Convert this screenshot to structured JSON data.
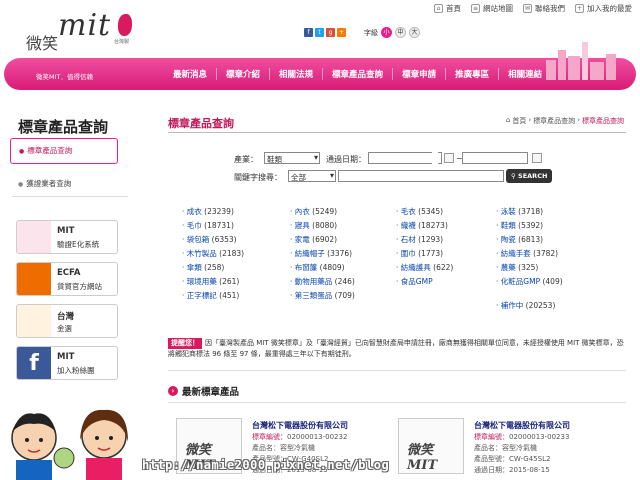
{
  "top_links": [
    {
      "icon": "home-icon",
      "label": "首頁"
    },
    {
      "icon": "sitemap-icon",
      "label": "網站地圖"
    },
    {
      "icon": "contact-icon",
      "label": "聯絡我們"
    },
    {
      "icon": "favorite-icon",
      "label": "加入我的最愛"
    }
  ],
  "logo": {
    "mit": "mit",
    "wei": "微笑",
    "tw": "台灣製"
  },
  "font_size": {
    "label": "字級",
    "options": [
      "小",
      "中",
      "大"
    ],
    "selected": 0
  },
  "nav": {
    "slogan": "微笑MIT．值得信賴",
    "items": [
      "最新消息",
      "標章介紹",
      "相關法規",
      "標章產品查詢",
      "標章申請",
      "推廣專區",
      "相關連結"
    ]
  },
  "sidebar": {
    "title": "標章產品查詢",
    "selected": "標章產品查詢",
    "item2": "獲證業者查詢",
    "banners": [
      {
        "icon": "mit-logo-icon",
        "line1": "MIT",
        "line2": "驗證E化系統"
      },
      {
        "icon": "ecfa-logo-icon",
        "line1": "ECFA",
        "line2": "貨貿官方網站"
      },
      {
        "icon": "taiwan-gold-icon",
        "line1": "台灣",
        "line2": "金選"
      },
      {
        "icon": "facebook-icon",
        "line1": "MIT",
        "line2": "加入粉絲團"
      }
    ]
  },
  "main": {
    "title": "標章產品查詢",
    "breadcrumb": [
      "首頁",
      "標章產品查詢",
      "標章產品查詢"
    ],
    "form": {
      "industry_label": "產業：",
      "industry_value": "鞋類",
      "date_label": "通過日期：",
      "date_sep": "~",
      "keyword_label": "關鍵字搜尋：",
      "keyword_scope": "全部",
      "keyword_value": "",
      "search_button": "SEARCH"
    },
    "categories": [
      [
        {
          "name": "成衣",
          "count": "(23239)"
        },
        {
          "name": "毛巾",
          "count": "(18731)"
        },
        {
          "name": "袋包箱",
          "count": "(6353)"
        },
        {
          "name": "木竹製品",
          "count": "(2183)"
        },
        {
          "name": "傘類",
          "count": "(258)"
        },
        {
          "name": "環境用藥",
          "count": "(261)"
        },
        {
          "name": "正字標記",
          "count": "(451)"
        }
      ],
      [
        {
          "name": "內衣",
          "count": "(5249)"
        },
        {
          "name": "寢具",
          "count": "(8080)"
        },
        {
          "name": "家電",
          "count": "(6902)"
        },
        {
          "name": "紡織帽子",
          "count": "(3376)"
        },
        {
          "name": "布窗簾",
          "count": "(4809)"
        },
        {
          "name": "動物用藥品",
          "count": "(246)"
        },
        {
          "name": "第三類蛋品",
          "count": "(709)"
        }
      ],
      [
        {
          "name": "毛衣",
          "count": "(5345)"
        },
        {
          "name": "織襪",
          "count": "(18273)"
        },
        {
          "name": "石材",
          "count": "(1293)"
        },
        {
          "name": "圍巾",
          "count": "(1773)"
        },
        {
          "name": "紡織護具",
          "count": "(622)"
        },
        {
          "name": "食品GMP",
          "count": ""
        }
      ],
      [
        {
          "name": "泳裝",
          "count": "(3718)"
        },
        {
          "name": "鞋類",
          "count": "(5392)"
        },
        {
          "name": "陶瓷",
          "count": "(6813)"
        },
        {
          "name": "紡織手套",
          "count": "(3782)"
        },
        {
          "name": "農藥",
          "count": "(325)"
        },
        {
          "name": "化粧品GMP",
          "count": "(409)"
        },
        {
          "name": "補作中",
          "count": "(20253)"
        }
      ]
    ],
    "notice": {
      "tag": "提醒您！",
      "text": "因「臺灣製產品 MIT 微笑標章」及「臺灣經貿」已向智慧財產局申請註冊，廠商無獲得相關單位同意，未經授權使用 MIT 微笑標章，恐將觸犯商標法 96 條至 97 條，最重得處三年以下有期徒刑。"
    },
    "new_title": "最新標章產品",
    "products": [
      {
        "company": "台灣松下電器股份有限公司",
        "code_label": "標章編號：",
        "code": "02000013-00232",
        "cat_label": "產品名：",
        "cat": "容型冷氣機",
        "model_label": "產品型號：",
        "model": "CW-G40SL2",
        "date_label": "通過日期：",
        "date": "2015-08-15"
      },
      {
        "company": "台灣松下電器股份有限公司",
        "code_label": "標章編號：",
        "code": "02000013-00233",
        "cat_label": "產品名：",
        "cat": "容型冷氣機",
        "model_label": "產品型號：",
        "model": "CW-G45SL2",
        "date_label": "通過日期：",
        "date": "2015-08-15"
      }
    ]
  },
  "watermark": "http://namie2000.pixnet.net/blog",
  "colors": {
    "brand": "#e91e8c",
    "brand_dark": "#c2185b",
    "link": "#0645ad"
  }
}
